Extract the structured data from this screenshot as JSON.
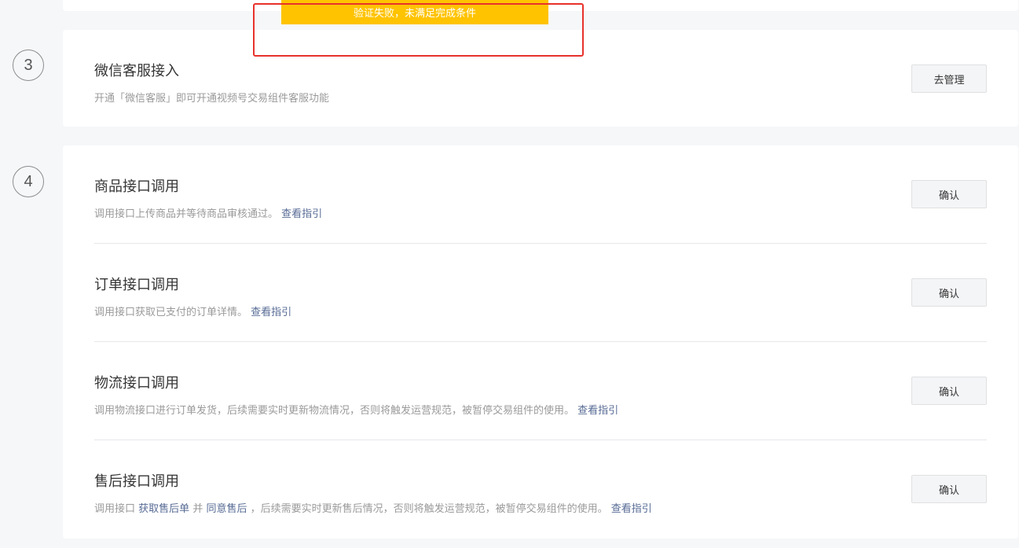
{
  "toast": {
    "message": "验证失败，未满足完成条件"
  },
  "steps": [
    {
      "number": "3",
      "items": [
        {
          "title": "微信客服接入",
          "desc": "开通「微信客服」即可开通视频号交易组件客服功能",
          "button": "去管理"
        }
      ]
    },
    {
      "number": "4",
      "items": [
        {
          "title": "商品接口调用",
          "desc": "调用接口上传商品并等待商品审核通过。",
          "link": "查看指引",
          "button": "确认"
        },
        {
          "title": "订单接口调用",
          "desc": "调用接口获取已支付的订单详情。",
          "link": "查看指引",
          "button": "确认"
        },
        {
          "title": "物流接口调用",
          "desc": "调用物流接口进行订单发货，后续需要实时更新物流情况，否则将触发运营规范，被暂停交易组件的使用。",
          "link": "查看指引",
          "button": "确认"
        },
        {
          "title": "售后接口调用",
          "desc_prefix": "调用接口",
          "link_a": "获取售后单",
          "desc_mid": "并",
          "link_b": "同意售后",
          "desc_suffix": "，后续需要实时更新售后情况，否则将触发运营规范，被暂停交易组件的使用。",
          "link": "查看指引",
          "button": "确认"
        }
      ]
    }
  ]
}
